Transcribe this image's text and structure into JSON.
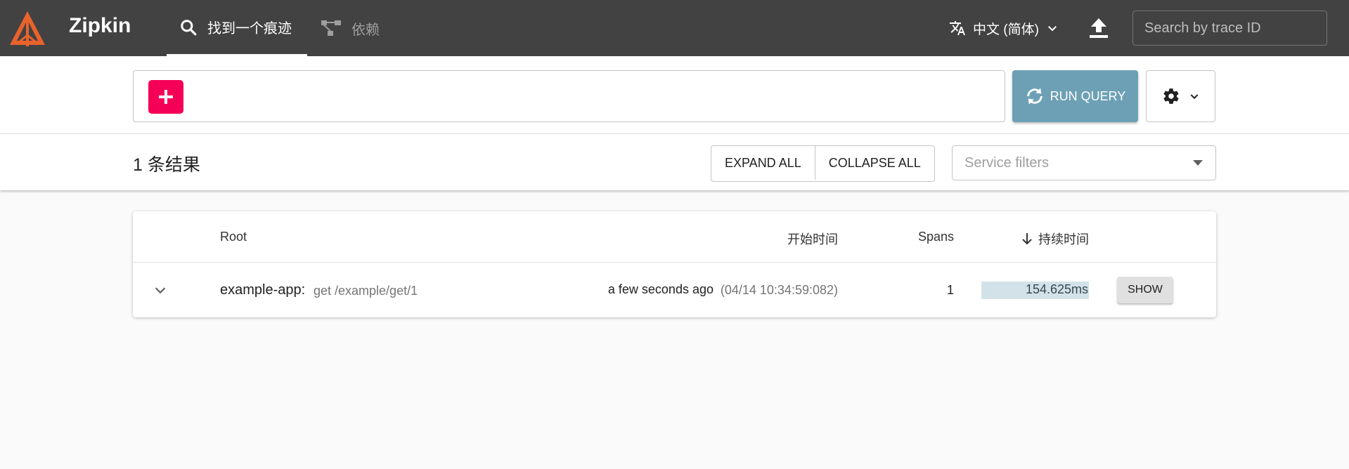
{
  "app": {
    "title": "Zipkin"
  },
  "nav": {
    "tabs": [
      {
        "label": "找到一个痕迹",
        "icon": "search-icon",
        "active": true
      },
      {
        "label": "依赖",
        "icon": "dependencies-icon",
        "active": false
      }
    ],
    "language": "中文 (简体)",
    "search_placeholder": "Search by trace ID"
  },
  "query": {
    "run_label": "RUN QUERY"
  },
  "results": {
    "count_label": "1 条结果",
    "expand_all": "EXPAND ALL",
    "collapse_all": "COLLAPSE ALL",
    "service_filter_placeholder": "Service filters"
  },
  "table": {
    "headers": {
      "root": "Root",
      "start_time": "开始时间",
      "spans": "Spans",
      "duration": "持续时间"
    },
    "rows": [
      {
        "service": "example-app:",
        "span": "get /example/get/1",
        "start_relative": "a few seconds ago",
        "start_absolute": "(04/14 10:34:59:082)",
        "spans": "1",
        "duration": "154.625ms",
        "duration_fraction": 1.0,
        "show_label": "SHOW"
      }
    ]
  },
  "colors": {
    "appbar": "#424242",
    "add_button": "#f50057",
    "run_button": "#6da0b5",
    "duration_bar": "#d3e2e9"
  }
}
